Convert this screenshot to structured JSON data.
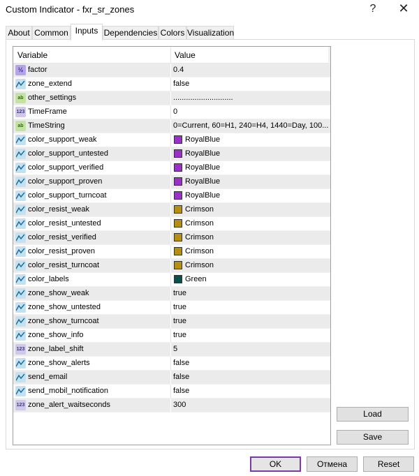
{
  "window": {
    "title": "Custom Indicator - fxr_sr_zones",
    "help_glyph": "?",
    "close_glyph": "✕"
  },
  "tabs": [
    "About",
    "Common",
    "Inputs",
    "Dependencies",
    "Colors",
    "Visualization"
  ],
  "active_tab": "Inputs",
  "table": {
    "columns": [
      "Variable",
      "Value"
    ],
    "rows": [
      {
        "icon": "double-icon",
        "name": "factor",
        "value": "0.4"
      },
      {
        "icon": "bool-icon",
        "name": "zone_extend",
        "value": "false"
      },
      {
        "icon": "string-icon",
        "name": "other_settings",
        "value": "............................"
      },
      {
        "icon": "int-icon",
        "name": "TimeFrame",
        "value": "0"
      },
      {
        "icon": "string-icon",
        "name": "TimeString",
        "value": "0=Current, 60=H1, 240=H4, 1440=Day, 100..."
      },
      {
        "icon": "color-icon",
        "name": "color_support_weak",
        "value": "RoyalBlue",
        "swatch": "#9b30c8"
      },
      {
        "icon": "color-icon",
        "name": "color_support_untested",
        "value": "RoyalBlue",
        "swatch": "#9b30c8"
      },
      {
        "icon": "color-icon",
        "name": "color_support_verified",
        "value": "RoyalBlue",
        "swatch": "#9b30c8"
      },
      {
        "icon": "color-icon",
        "name": "color_support_proven",
        "value": "RoyalBlue",
        "swatch": "#9b30c8"
      },
      {
        "icon": "color-icon",
        "name": "color_support_turncoat",
        "value": "RoyalBlue",
        "swatch": "#9b30c8"
      },
      {
        "icon": "color-icon",
        "name": "color_resist_weak",
        "value": "Crimson",
        "swatch": "#b58f12"
      },
      {
        "icon": "color-icon",
        "name": "color_resist_untested",
        "value": "Crimson",
        "swatch": "#b58f12"
      },
      {
        "icon": "color-icon",
        "name": "color_resist_verified",
        "value": "Crimson",
        "swatch": "#b58f12"
      },
      {
        "icon": "color-icon",
        "name": "color_resist_proven",
        "value": "Crimson",
        "swatch": "#b58f12"
      },
      {
        "icon": "color-icon",
        "name": "color_resist_turncoat",
        "value": "Crimson",
        "swatch": "#b58f12"
      },
      {
        "icon": "color-icon",
        "name": "color_labels",
        "value": "Green",
        "swatch": "#0b4f4a"
      },
      {
        "icon": "bool-icon",
        "name": "zone_show_weak",
        "value": "true"
      },
      {
        "icon": "bool-icon",
        "name": "zone_show_untested",
        "value": "true"
      },
      {
        "icon": "bool-icon",
        "name": "zone_show_turncoat",
        "value": "true"
      },
      {
        "icon": "bool-icon",
        "name": "zone_show_info",
        "value": "true"
      },
      {
        "icon": "int-icon",
        "name": "zone_label_shift",
        "value": "5"
      },
      {
        "icon": "bool-icon",
        "name": "zone_show_alerts",
        "value": "false"
      },
      {
        "icon": "bool-icon",
        "name": "send_email",
        "value": "false"
      },
      {
        "icon": "bool-icon",
        "name": "send_mobil_notification",
        "value": "false"
      },
      {
        "icon": "int-icon",
        "name": "zone_alert_waitseconds",
        "value": "300"
      }
    ]
  },
  "side_buttons": {
    "load": "Load",
    "save": "Save"
  },
  "footer_buttons": {
    "ok": "OK",
    "cancel": "Отмена",
    "reset": "Reset"
  },
  "colors": {
    "ok_border": "#7a3aa8",
    "odd_row": "#ebebeb"
  }
}
